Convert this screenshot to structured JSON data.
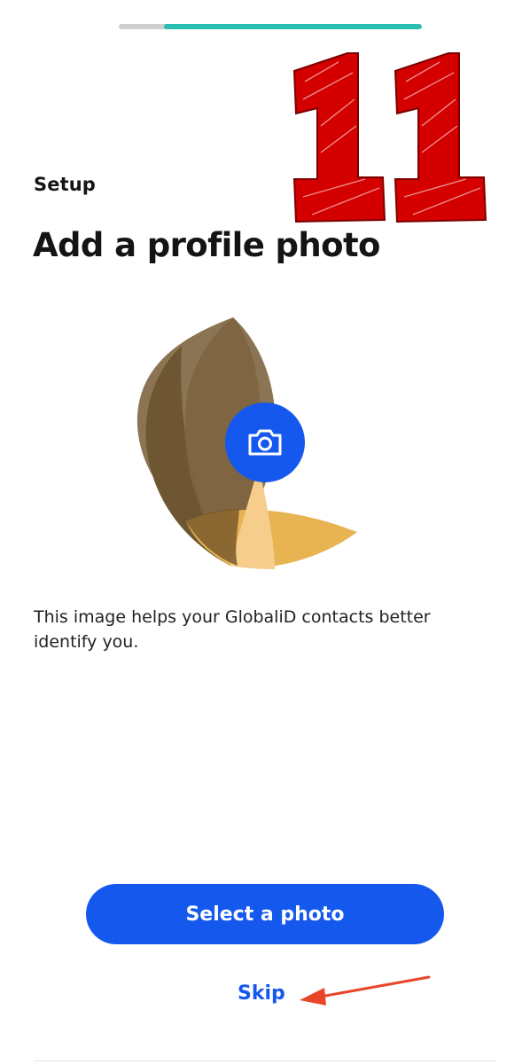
{
  "progress": {
    "fraction": 0.85,
    "track_color": "#cfcfcf",
    "fill_color": "#2bbfb3"
  },
  "annotation": {
    "number_text": "11",
    "number_color": "#d40000",
    "arrow_color": "#e8452a"
  },
  "header": {
    "section_label": "Setup",
    "title": "Add a profile photo"
  },
  "illustration": {
    "camera_button_icon": "camera-icon",
    "camera_button_color": "#1458ee",
    "palette": [
      "#8b7453",
      "#6e5632",
      "#a88d62",
      "#e8b452",
      "#f6cd8c",
      "#f9dfb0"
    ]
  },
  "body": {
    "description": "This image helps your GlobaliD contacts better identify you."
  },
  "actions": {
    "primary_label": "Select a photo",
    "skip_label": "Skip",
    "accent_color": "#1458ee"
  }
}
